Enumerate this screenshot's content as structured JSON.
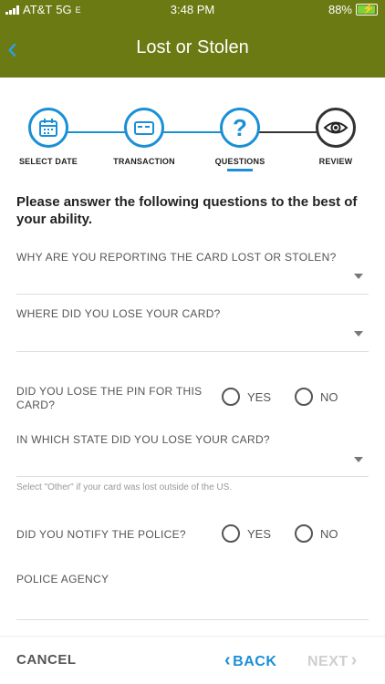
{
  "status_bar": {
    "carrier": "AT&T",
    "network": "5G",
    "network_suffix": "E",
    "time": "3:48 PM",
    "battery": "88%"
  },
  "header": {
    "title": "Lost or Stolen"
  },
  "steps": [
    {
      "label": "SELECT DATE",
      "icon": "calendar-icon"
    },
    {
      "label": "TRANSACTION",
      "icon": "card-icon"
    },
    {
      "label": "QUESTIONS",
      "icon": "question-icon",
      "active": true
    },
    {
      "label": "REVIEW",
      "icon": "eye-icon"
    }
  ],
  "form": {
    "heading": "Please answer the following questions to the best of your ability.",
    "q1_label": "WHY ARE YOU REPORTING THE CARD LOST OR STOLEN?",
    "q2_label": "WHERE DID YOU LOSE YOUR CARD?",
    "q3_label": "DID YOU LOSE THE PIN FOR THIS CARD?",
    "q4_label": "IN WHICH STATE DID YOU LOSE YOUR CARD?",
    "q4_hint": "Select \"Other\" if your card was lost outside of the US.",
    "q5_label": "DID YOU NOTIFY THE POLICE?",
    "q6_label": "POLICE AGENCY",
    "yes": "YES",
    "no": "NO"
  },
  "footer": {
    "cancel": "CANCEL",
    "back": "BACK",
    "next": "NEXT"
  },
  "colors": {
    "header_bg": "#6b7a12",
    "accent": "#1a8fd6",
    "disabled": "#cfcfcf"
  }
}
